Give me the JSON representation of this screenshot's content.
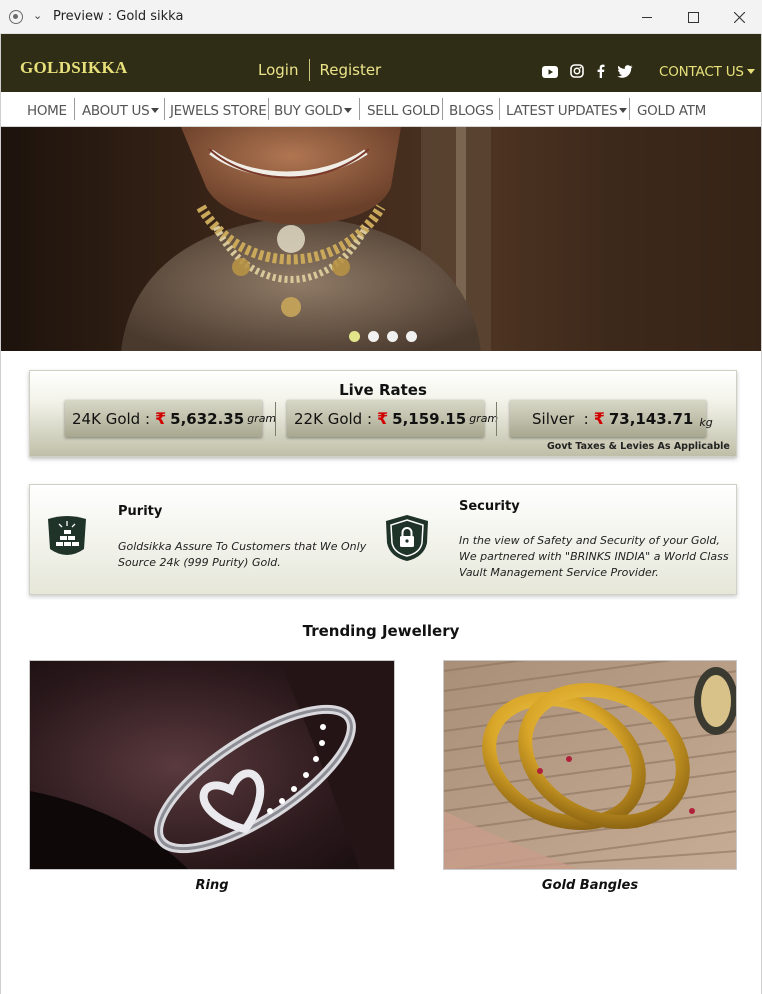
{
  "window": {
    "title": "Preview : Gold sikka"
  },
  "header": {
    "logo": "GOLDSIKKA",
    "login": "Login",
    "register": "Register",
    "social": [
      "youtube-icon",
      "instagram-icon",
      "facebook-icon",
      "twitter-icon"
    ],
    "contact": "CONTACT US"
  },
  "nav": {
    "items": [
      "HOME",
      "ABOUT US",
      "JEWELS STORE",
      "BUY GOLD",
      "SELL GOLD",
      "BLOGS",
      "LATEST UPDATES",
      "GOLD ATM"
    ]
  },
  "hero": {
    "slides": 4,
    "active_slide": 1
  },
  "rates": {
    "title": "Live Rates",
    "currency_symbol": "₹",
    "gold24": {
      "label": "24K Gold :",
      "value": "5,632.35",
      "unit": "gram"
    },
    "gold22": {
      "label": "22K Gold :",
      "value": "5,159.15",
      "unit": "gram"
    },
    "silver": {
      "label": "Silver  :",
      "value": "73,143.71",
      "unit": "kg"
    },
    "note": "Govt Taxes & Levies As Applicable"
  },
  "features": {
    "purity": {
      "title": "Purity",
      "text": "Goldsikka Assure To Customers that We Only Source 24k (999 Purity) Gold."
    },
    "security": {
      "title": "Security",
      "text": "In the view of Safety and Security of your Gold, We partnered with \"BRINKS INDIA\" a World Class Vault Management Service Provider."
    }
  },
  "trending": {
    "title": "Trending Jewellery",
    "products": [
      {
        "name": "Ring"
      },
      {
        "name": "Gold Bangles"
      }
    ]
  },
  "colors": {
    "header_bg": "#2f2d15",
    "accent": "#e8e07a",
    "rupee": "#d10000",
    "icon_dark": "#1f3328"
  }
}
